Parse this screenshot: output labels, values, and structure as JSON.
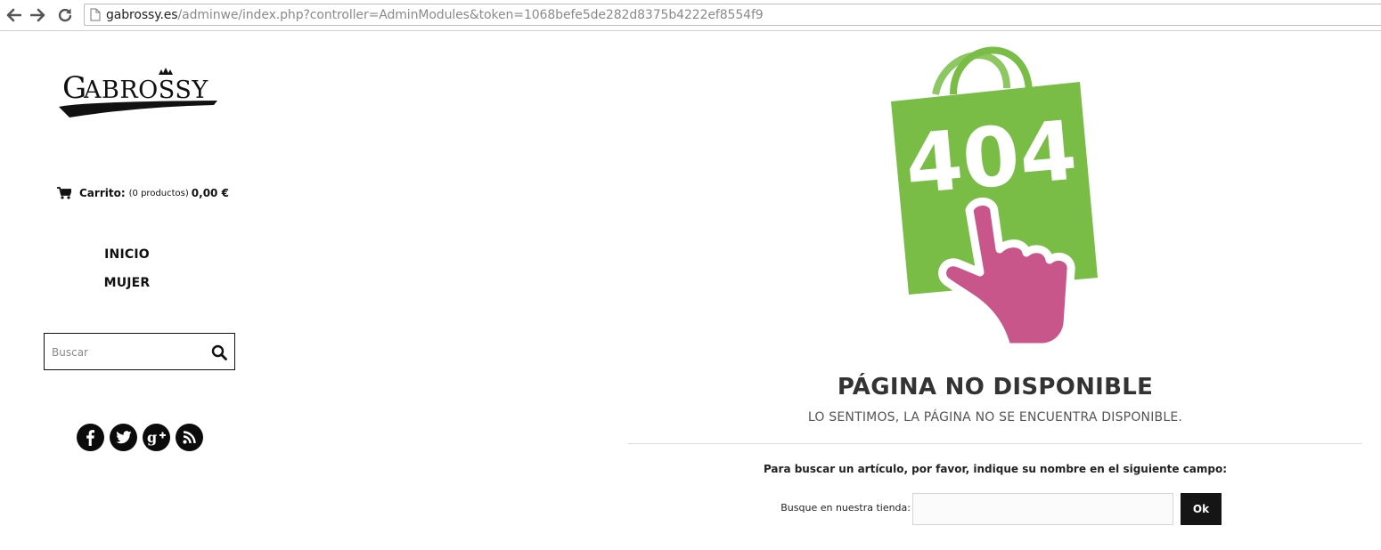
{
  "browser": {
    "url_host": "gabrossy.es",
    "url_path": "/adminwe/index.php?controller=AdminModules&token=1068befe5de282d8375b4222ef8554f9"
  },
  "sidebar": {
    "logo_text": "GABROSSY",
    "cart": {
      "label": "Carrito:",
      "count": "(0 productos)",
      "total": "0,00 €"
    },
    "menu": [
      {
        "label": "INICIO"
      },
      {
        "label": "MUJER"
      }
    ],
    "search": {
      "placeholder": "Buscar"
    },
    "social": [
      "facebook-icon",
      "twitter-icon",
      "google-plus-icon",
      "rss-icon"
    ]
  },
  "main": {
    "illustration_text": "404",
    "title": "PÁGINA NO DISPONIBLE",
    "subtitle": "LO SENTIMOS, LA PÁGINA NO SE ENCUENTRA DISPONIBLE.",
    "instruction": "Para buscar un artículo, por favor, indique su nombre en el siguiente campo:",
    "search_label": "Busque en nuestra tienda:",
    "search_value": "",
    "ok_label": "Ok"
  },
  "colors": {
    "bag_green": "#79bd47",
    "hand_pink": "#c9568b",
    "button_dark": "#151515"
  }
}
